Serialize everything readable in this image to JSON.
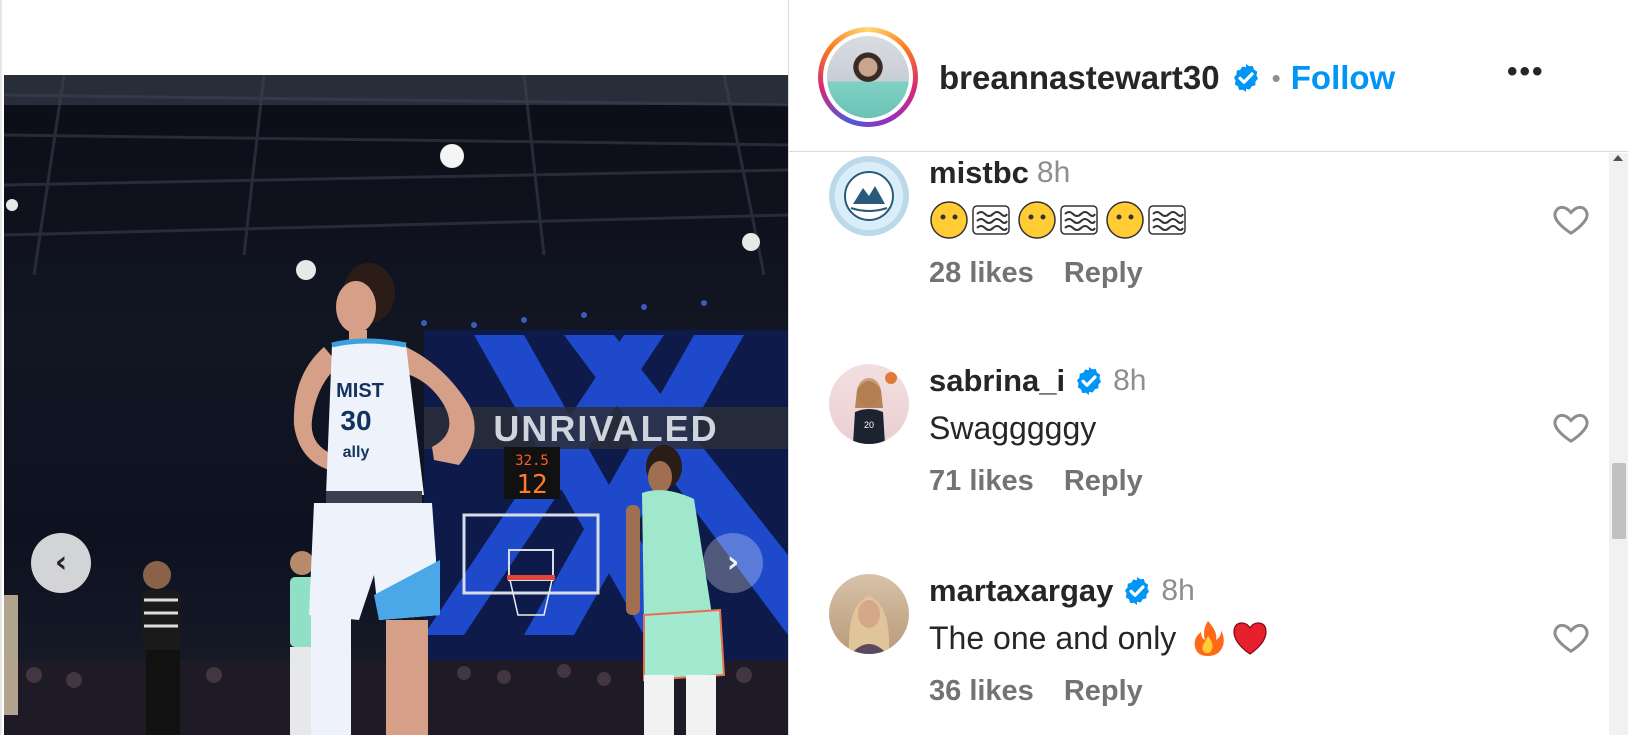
{
  "post": {
    "owner": {
      "username": "breannastewart30",
      "verified": true,
      "separator": "•",
      "follow_label": "Follow",
      "more_label": "•••"
    },
    "media": {
      "jersey_team": "MIST",
      "jersey_number": "30",
      "jersey_sponsor": "ally",
      "banner_text": "UNRIVALED",
      "shot_clock_top": "32.5",
      "shot_clock_main": "12",
      "prev_icon": "chevron-left-icon",
      "next_icon": "chevron-right-icon"
    }
  },
  "comments": [
    {
      "username": "mistbc",
      "verified": false,
      "time": "8h",
      "text": "",
      "emoji": [
        "face-neutral",
        "water-wave",
        "face-neutral",
        "water-wave",
        "face-neutral",
        "water-wave"
      ],
      "likes": "28 likes",
      "reply_label": "Reply"
    },
    {
      "username": "sabrina_i",
      "verified": true,
      "time": "8h",
      "text": "Swagggggy",
      "likes": "71 likes",
      "reply_label": "Reply"
    },
    {
      "username": "martaxargay",
      "verified": true,
      "time": "8h",
      "text": "The one and only",
      "emoji": [
        "fire",
        "red-heart"
      ],
      "likes": "36 likes",
      "reply_label": "Reply"
    }
  ],
  "colors": {
    "accent": "#0095f6",
    "muted": "#8e8e8e",
    "text": "#262626",
    "border": "#dbdbdb"
  }
}
